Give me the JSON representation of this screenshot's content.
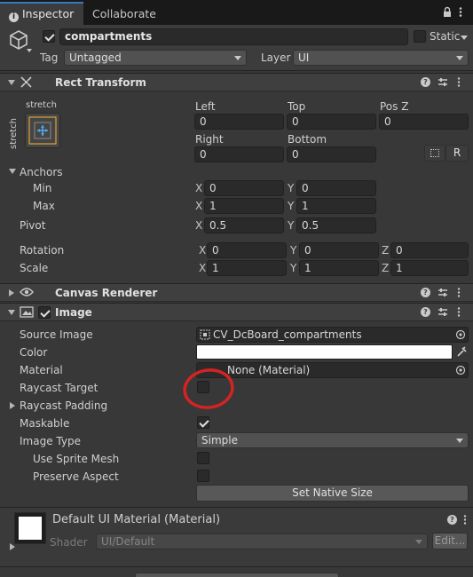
{
  "tabs": {
    "inspector": "Inspector",
    "collaborate": "Collaborate"
  },
  "object": {
    "name": "compartments",
    "static_label": "Static",
    "tag_label": "Tag",
    "tag_value": "Untagged",
    "layer_label": "Layer",
    "layer_value": "UI"
  },
  "rect_transform": {
    "title": "Rect Transform",
    "anchor_h": "stretch",
    "anchor_v": "stretch",
    "left_label": "Left",
    "left": "0",
    "top_label": "Top",
    "top": "0",
    "posz_label": "Pos Z",
    "posz": "0",
    "right_label": "Right",
    "right": "0",
    "bottom_label": "Bottom",
    "bottom": "0",
    "r_button": "R",
    "anchors_label": "Anchors",
    "min_label": "Min",
    "min_x": "0",
    "min_y": "0",
    "max_label": "Max",
    "max_x": "1",
    "max_y": "1",
    "pivot_label": "Pivot",
    "pivot_x": "0.5",
    "pivot_y": "0.5",
    "rotation_label": "Rotation",
    "rot_x": "0",
    "rot_y": "0",
    "rot_z": "0",
    "scale_label": "Scale",
    "scale_x": "1",
    "scale_y": "1",
    "scale_z": "1",
    "x": "X",
    "y": "Y",
    "z": "Z"
  },
  "canvas_renderer": {
    "title": "Canvas Renderer"
  },
  "image": {
    "title": "Image",
    "source_image_label": "Source Image",
    "source_image": "CV_DcBoard_compartments",
    "color_label": "Color",
    "material_label": "Material",
    "material": "None (Material)",
    "raycast_target_label": "Raycast Target",
    "raycast_padding_label": "Raycast Padding",
    "maskable_label": "Maskable",
    "image_type_label": "Image Type",
    "image_type": "Simple",
    "use_sprite_mesh_label": "Use Sprite Mesh",
    "preserve_aspect_label": "Preserve Aspect",
    "set_native_size": "Set Native Size"
  },
  "material_section": {
    "title": "Default UI Material (Material)",
    "shader_label": "Shader",
    "shader_value": "UI/Default",
    "edit_button": "Edit..."
  },
  "colors": {
    "accent": "#3a79bb",
    "annotation": "#d42323",
    "color_swatch": "#ffffff"
  }
}
